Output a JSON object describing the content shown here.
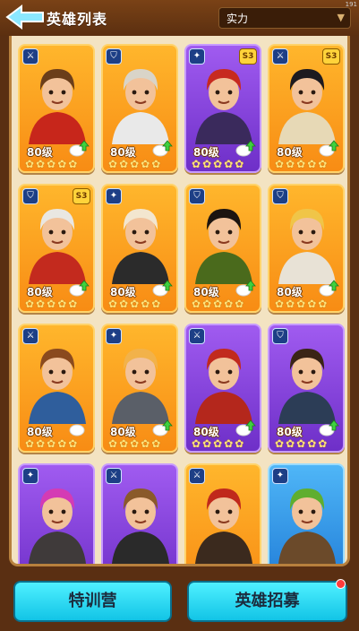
{
  "header": {
    "title": "英雄列表",
    "sort_label": "实力",
    "corner_badge": "191"
  },
  "heroes": [
    {
      "level": "80级",
      "stars": 5,
      "rarity": "orange",
      "role_icon": "crossed-swords-icon",
      "skin_badge": "",
      "upgradable": true,
      "hair": "#6b3e1a",
      "outfit": "#c7261b"
    },
    {
      "level": "80级",
      "stars": 5,
      "rarity": "orange",
      "role_icon": "shield-icon",
      "skin_badge": "",
      "upgradable": true,
      "hair": "#d9d4c8",
      "outfit": "#e9e9e9"
    },
    {
      "level": "80级",
      "stars": 5,
      "rarity": "purple",
      "role_icon": "magic-icon",
      "skin_badge": "S3",
      "upgradable": true,
      "hair": "#c72a1f",
      "outfit": "#3a2a5c"
    },
    {
      "level": "80级",
      "stars": 5,
      "rarity": "orange",
      "role_icon": "crossed-swords-icon",
      "skin_badge": "S3",
      "upgradable": true,
      "hair": "#1d1a1f",
      "outfit": "#e7d9b6"
    },
    {
      "level": "80级",
      "stars": 5,
      "rarity": "orange",
      "role_icon": "shield-icon",
      "skin_badge": "S3",
      "upgradable": true,
      "hair": "#e9e7e2",
      "outfit": "#c32a1e"
    },
    {
      "level": "80级",
      "stars": 5,
      "rarity": "orange",
      "role_icon": "magic-icon",
      "skin_badge": "",
      "upgradable": true,
      "hair": "#f3e6cf",
      "outfit": "#2b2b2b"
    },
    {
      "level": "80级",
      "stars": 5,
      "rarity": "orange",
      "role_icon": "shield-icon",
      "skin_badge": "",
      "upgradable": true,
      "hair": "#1c1410",
      "outfit": "#4a6a1c"
    },
    {
      "level": "80级",
      "stars": 5,
      "rarity": "orange",
      "role_icon": "shield-icon",
      "skin_badge": "",
      "upgradable": true,
      "hair": "#f0c548",
      "outfit": "#e8e2d6"
    },
    {
      "level": "80级",
      "stars": 5,
      "rarity": "orange",
      "role_icon": "crossed-swords-icon",
      "skin_badge": "",
      "upgradable": false,
      "hair": "#8a4a1e",
      "outfit": "#2f5e9c"
    },
    {
      "level": "80级",
      "stars": 5,
      "rarity": "orange",
      "role_icon": "magic-icon",
      "skin_badge": "",
      "upgradable": true,
      "hair": "#f2b24a",
      "outfit": "#5a5f68"
    },
    {
      "level": "80级",
      "stars": 5,
      "rarity": "purple",
      "role_icon": "crossed-swords-icon",
      "skin_badge": "",
      "upgradable": true,
      "hair": "#c12a1e",
      "outfit": "#b4271c"
    },
    {
      "level": "80级",
      "stars": 5,
      "rarity": "purple",
      "role_icon": "shield-icon",
      "skin_badge": "",
      "upgradable": true,
      "hair": "#3a2416",
      "outfit": "#2c3d56"
    },
    {
      "level": "",
      "stars": 0,
      "rarity": "purple",
      "role_icon": "magic-icon",
      "skin_badge": "",
      "upgradable": false,
      "hair": "#d43bb4",
      "outfit": "#3f3a3a"
    },
    {
      "level": "",
      "stars": 0,
      "rarity": "purple",
      "role_icon": "crossed-swords-icon",
      "skin_badge": "",
      "upgradable": false,
      "hair": "#8a5a2a",
      "outfit": "#2a2a2a"
    },
    {
      "level": "",
      "stars": 0,
      "rarity": "orange",
      "role_icon": "crossed-swords-icon",
      "skin_badge": "",
      "upgradable": false,
      "hair": "#c0291c",
      "outfit": "#3b2a1e"
    },
    {
      "level": "",
      "stars": 0,
      "rarity": "blue",
      "role_icon": "magic-icon",
      "skin_badge": "",
      "upgradable": false,
      "hair": "#5fae2f",
      "outfit": "#6b4a2a"
    }
  ],
  "buttons": {
    "training_camp": "特训营",
    "recruit": "英雄招募"
  },
  "colors": {
    "accent_button": "#12c4e6",
    "panel_bg": "#f3e3c2",
    "frame_brown": "#5a2f12"
  }
}
